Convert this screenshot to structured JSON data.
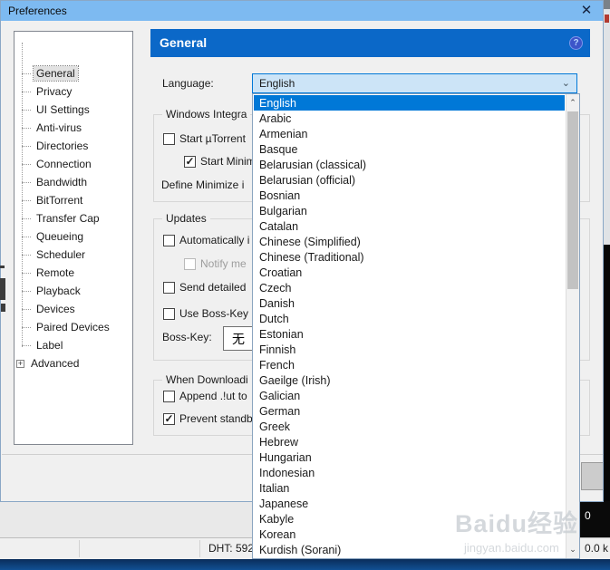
{
  "window": {
    "title": "Preferences",
    "close_glyph": "✕"
  },
  "sidebar": {
    "items": [
      {
        "label": "General",
        "selected": true
      },
      {
        "label": "Privacy"
      },
      {
        "label": "UI Settings"
      },
      {
        "label": "Anti-virus"
      },
      {
        "label": "Directories"
      },
      {
        "label": "Connection"
      },
      {
        "label": "Bandwidth"
      },
      {
        "label": "BitTorrent"
      },
      {
        "label": "Transfer Cap"
      },
      {
        "label": "Queueing"
      },
      {
        "label": "Scheduler"
      },
      {
        "label": "Remote"
      },
      {
        "label": "Playback"
      },
      {
        "label": "Devices"
      },
      {
        "label": "Paired Devices"
      },
      {
        "label": "Label"
      },
      {
        "label": "Advanced",
        "expandable": true,
        "expander_glyph": "+"
      }
    ]
  },
  "panel": {
    "title": "General",
    "help_glyph": "?"
  },
  "language": {
    "label": "Language:",
    "value": "English",
    "chevron_glyph": "⌄"
  },
  "dropdown": {
    "selected_index": 0,
    "up_glyph": "⌃",
    "down_glyph": "⌄",
    "options": [
      "English",
      "Arabic",
      "Armenian",
      "Basque",
      "Belarusian (classical)",
      "Belarusian (official)",
      "Bosnian",
      "Bulgarian",
      "Catalan",
      "Chinese (Simplified)",
      "Chinese (Traditional)",
      "Croatian",
      "Czech",
      "Danish",
      "Dutch",
      "Estonian",
      "Finnish",
      "French",
      "Gaeilge (Irish)",
      "Galician",
      "German",
      "Greek",
      "Hebrew",
      "Hungarian",
      "Indonesian",
      "Italian",
      "Japanese",
      "Kabyle",
      "Korean",
      "Kurdish (Sorani)"
    ]
  },
  "groups": {
    "windows_integration": {
      "title": "Windows Integra",
      "items": [
        {
          "label": "Start µTorrent ",
          "checked": false,
          "mark": ""
        },
        {
          "label": "Start Minim",
          "checked": true,
          "mark": "✓"
        }
      ],
      "define_minimize": "Define Minimize i"
    },
    "updates": {
      "title": "Updates",
      "items": [
        {
          "label": "Automatically i",
          "checked": false,
          "mark": ""
        },
        {
          "label": "Notify me ",
          "checked": false,
          "disabled": true,
          "mark": ""
        },
        {
          "label": "Send detailed ",
          "checked": false,
          "mark": ""
        },
        {
          "label": "Use Boss-Key ",
          "checked": false,
          "mark": ""
        }
      ],
      "boss_key_label": "Boss-Key:",
      "boss_key_value": "无"
    },
    "when_downloading": {
      "title": "When Downloadi",
      "items": [
        {
          "label": "Append .!ut to ",
          "checked": false,
          "mark": ""
        },
        {
          "label": "Prevent standb",
          "checked": true,
          "mark": "✓"
        }
      ]
    }
  },
  "status_bar": {
    "dht": "DHT: 592",
    "speed": "0.0 k",
    "overlay_value": "0"
  },
  "watermark": {
    "brand": "Baidu经验",
    "url": "jingyan.baidu.com"
  },
  "colors": {
    "accent": "#0078d7",
    "header_blue": "#0b68c8",
    "titlebar_blue": "#7dbaf1",
    "combo_fill": "#cce4f7",
    "selection_blue": "#0078d7"
  }
}
